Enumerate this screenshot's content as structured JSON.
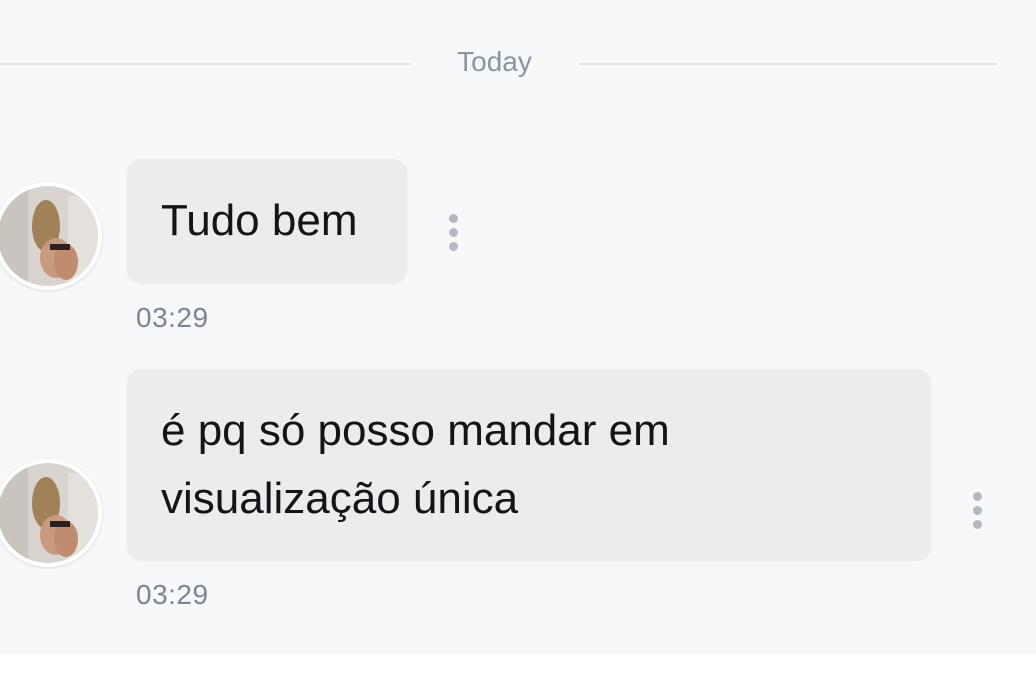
{
  "date_divider": {
    "label": "Today"
  },
  "messages": [
    {
      "text": "Tudo bem",
      "time": "03:29",
      "avatar_icon": "contact-avatar",
      "menu_icon": "more-vertical-icon"
    },
    {
      "text": "é pq só posso mandar em visualização única",
      "time": "03:29",
      "avatar_icon": "contact-avatar",
      "menu_icon": "more-vertical-icon"
    }
  ],
  "colors": {
    "background": "#f7f8fa",
    "bubble": "#ececef",
    "text": "#121418",
    "muted": "#7b8493",
    "divider": "#dfe2e7"
  }
}
